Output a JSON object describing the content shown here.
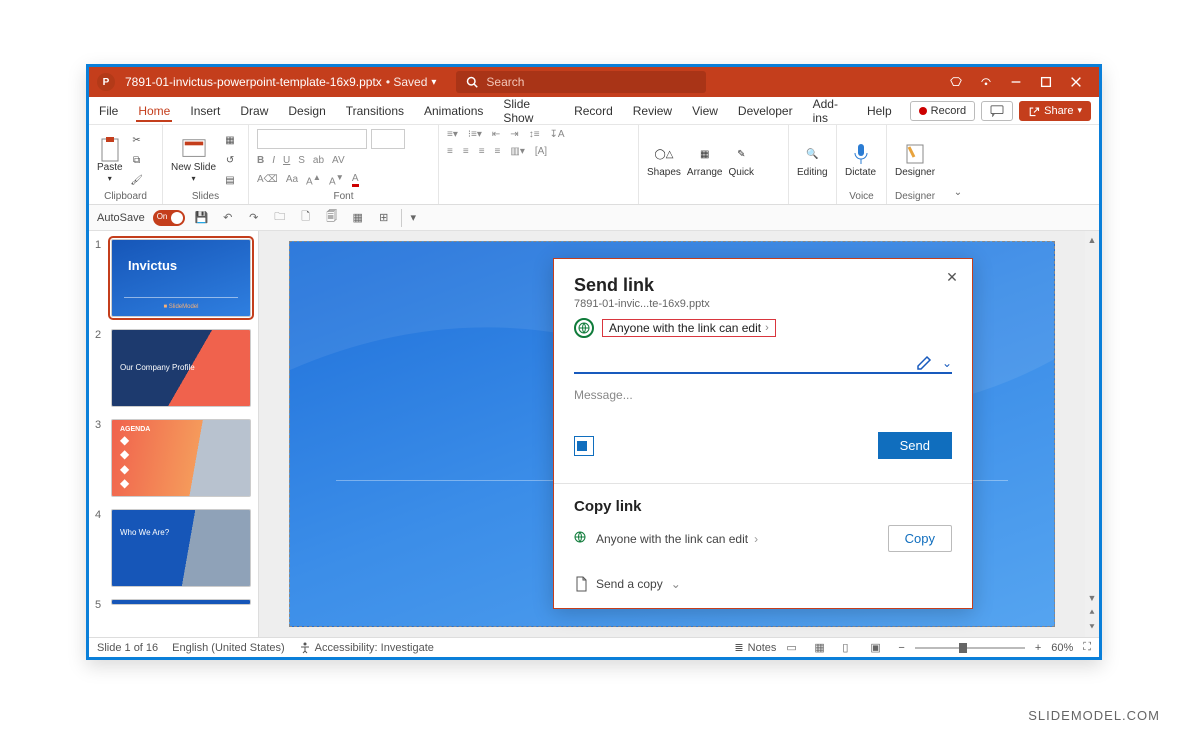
{
  "titlebar": {
    "filename": "7891-01-invictus-powerpoint-template-16x9.pptx",
    "saved_status": "• Saved",
    "search_placeholder": "Search"
  },
  "menu": {
    "tabs": [
      "File",
      "Home",
      "Insert",
      "Draw",
      "Design",
      "Transitions",
      "Animations",
      "Slide Show",
      "Record",
      "Review",
      "View",
      "Developer",
      "Add-ins",
      "Help"
    ],
    "active_tab": "Home",
    "record_btn": "Record",
    "share_btn": "Share"
  },
  "ribbon": {
    "paste": "Paste",
    "clipboard_label": "Clipboard",
    "new_slide": "New Slide",
    "slides_label": "Slides",
    "font_label": "Font",
    "shapes": "Shapes",
    "arrange": "Arrange",
    "quick": "Quick",
    "editing": "Editing",
    "dictate": "Dictate",
    "voice_label": "Voice",
    "designer": "Designer",
    "designer_label": "Designer"
  },
  "qat": {
    "autosave_label": "AutoSave",
    "autosave_on": "On"
  },
  "thumbs": [
    {
      "num": "1",
      "title": "Invictus"
    },
    {
      "num": "2",
      "title": "Our Company Profile"
    },
    {
      "num": "3",
      "title": "AGENDA"
    },
    {
      "num": "4",
      "title": "Who We Are?"
    },
    {
      "num": "5",
      "title": ""
    }
  ],
  "statusbar": {
    "slide_count": "Slide 1 of 16",
    "language": "English (United States)",
    "accessibility": "Accessibility: Investigate",
    "notes": "Notes",
    "zoom": "60%"
  },
  "dialog": {
    "title": "Send link",
    "filename": "7891-01-invic...te-16x9.pptx",
    "permission": "Anyone with the link can edit",
    "message_placeholder": "Message...",
    "send": "Send",
    "copy_title": "Copy link",
    "copy_permission": "Anyone with the link can edit",
    "copy_btn": "Copy",
    "send_copy": "Send a copy"
  },
  "watermark": "SLIDEMODEL.COM"
}
